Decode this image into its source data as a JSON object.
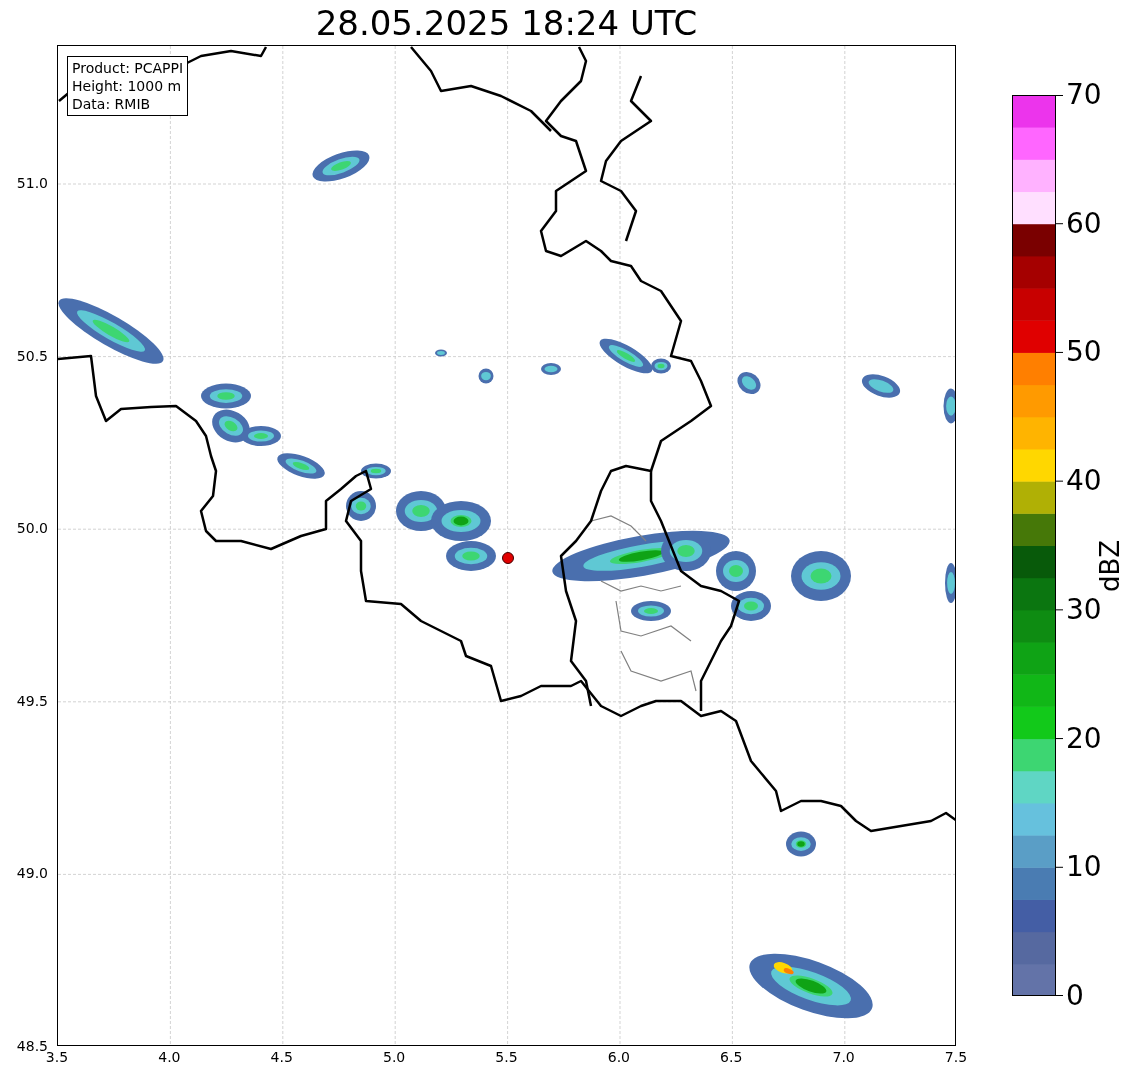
{
  "title": "28.05.2025 18:24 UTC",
  "info_box": [
    "Product: PCAPPI",
    "Height: 1000 m",
    "Data: RMIB"
  ],
  "x_ticks": [
    "3.5",
    "4.0",
    "4.5",
    "5.0",
    "5.5",
    "6.0",
    "6.5",
    "7.0",
    "7.5"
  ],
  "y_ticks": [
    "51.0",
    "50.5",
    "50.0",
    "49.5",
    "49.0",
    "48.5"
  ],
  "colorbar": {
    "label": "dBZ",
    "ticks": [
      "70",
      "60",
      "50",
      "40",
      "30",
      "20",
      "10",
      "0"
    ]
  }
}
